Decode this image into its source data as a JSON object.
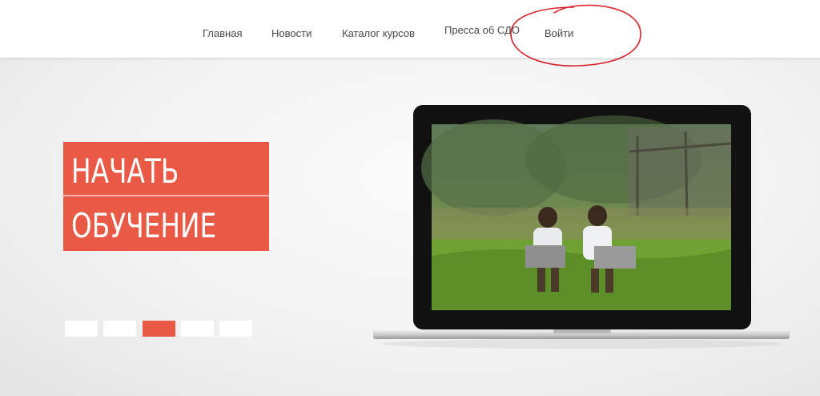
{
  "nav": {
    "items": [
      {
        "label": "Главная"
      },
      {
        "label": "Новости"
      },
      {
        "label": "Каталог курсов"
      },
      {
        "label": "Пресса об СДО"
      },
      {
        "label": "Войти"
      }
    ]
  },
  "hero": {
    "cta_line1": "НАЧАТЬ",
    "cta_line2": "ОБУЧЕНИЕ",
    "slider": {
      "count": 5,
      "active_index": 2
    }
  },
  "colors": {
    "accent": "#e85a45",
    "annotation": "#d8222a",
    "nav_text": "#4a4a4a"
  },
  "icons": {
    "laptop": "laptop-illustration",
    "photo": "children-with-laptops-photo"
  }
}
